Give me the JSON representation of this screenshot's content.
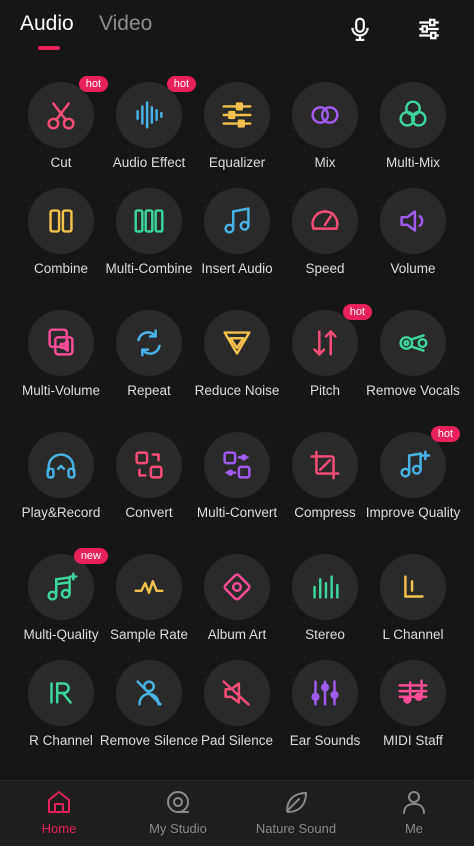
{
  "header": {
    "tabs": [
      {
        "label": "Audio",
        "active": true
      },
      {
        "label": "Video",
        "active": false
      }
    ],
    "icons": [
      "mic-icon",
      "sliders-icon"
    ]
  },
  "grid": [
    {
      "label": "Cut",
      "icon": "scissors-icon",
      "color": "#ff4d7a",
      "badge": "hot"
    },
    {
      "label": "Audio Effect",
      "icon": "waveform-icon",
      "color": "#4ab3e6",
      "badge": "hot"
    },
    {
      "label": "Equalizer",
      "icon": "equalizer-icon",
      "color": "#f2c14e",
      "badge": ""
    },
    {
      "label": "Mix",
      "icon": "mix-circles-icon",
      "color": "#a05cf0",
      "badge": ""
    },
    {
      "label": "Multi-Mix",
      "icon": "multi-mix-icon",
      "color": "#3ed6a0",
      "badge": ""
    },
    {
      "label": "Combine",
      "icon": "combine-icon",
      "color": "#f2c14e",
      "badge": ""
    },
    {
      "label": "Multi-Combine",
      "icon": "multi-combine-icon",
      "color": "#3ed6a0",
      "badge": ""
    },
    {
      "label": "Insert Audio",
      "icon": "music-notes-icon",
      "color": "#4ab3e6",
      "badge": ""
    },
    {
      "label": "Speed",
      "icon": "speedometer-icon",
      "color": "#ff4d7a",
      "badge": ""
    },
    {
      "label": "Volume",
      "icon": "speaker-icon",
      "color": "#a05cf0",
      "badge": ""
    },
    {
      "label": "Multi-Volume",
      "icon": "multi-volume-icon",
      "color": "#ff4d9a",
      "badge": ""
    },
    {
      "label": "Repeat",
      "icon": "repeat-icon",
      "color": "#4ab3e6",
      "badge": ""
    },
    {
      "label": "Reduce Noise",
      "icon": "funnel-icon",
      "color": "#f2c14e",
      "badge": ""
    },
    {
      "label": "Pitch",
      "icon": "pitch-icon",
      "color": "#ff4d7a",
      "badge": "hot"
    },
    {
      "label": "Remove Vocals",
      "icon": "remove-vocals-icon",
      "color": "#3ed6a0",
      "badge": ""
    },
    {
      "label": "Play&Record",
      "icon": "headphones-icon",
      "color": "#4ab3e6",
      "badge": ""
    },
    {
      "label": "Convert",
      "icon": "convert-icon",
      "color": "#ff4d7a",
      "badge": ""
    },
    {
      "label": "Multi-Convert",
      "icon": "multi-convert-icon",
      "color": "#a05cf0",
      "badge": ""
    },
    {
      "label": "Compress",
      "icon": "compress-icon",
      "color": "#ff4d7a",
      "badge": ""
    },
    {
      "label": "Improve Quality",
      "icon": "music-note-plus-icon",
      "color": "#4ab3e6",
      "badge": "hot"
    },
    {
      "label": "Multi-Quality",
      "icon": "multi-quality-icon",
      "color": "#3ed6a0",
      "badge": "new"
    },
    {
      "label": "Sample Rate",
      "icon": "sample-rate-icon",
      "color": "#f2c14e",
      "badge": ""
    },
    {
      "label": "Album Art",
      "icon": "album-art-icon",
      "color": "#ff4d9a",
      "badge": ""
    },
    {
      "label": "Stereo",
      "icon": "stereo-bars-icon",
      "color": "#3ed6a0",
      "badge": ""
    },
    {
      "label": "L Channel",
      "icon": "l-channel-icon",
      "color": "#f2c14e",
      "badge": ""
    },
    {
      "label": "R Channel",
      "icon": "r-channel-icon",
      "color": "#3ed6a0",
      "badge": ""
    },
    {
      "label": "Remove Silence",
      "icon": "remove-silence-icon",
      "color": "#4ab3e6",
      "badge": ""
    },
    {
      "label": "Pad Silence",
      "icon": "mute-speaker-icon",
      "color": "#ff4d7a",
      "badge": ""
    },
    {
      "label": "Ear Sounds",
      "icon": "ear-sounds-icon",
      "color": "#a05cf0",
      "badge": ""
    },
    {
      "label": "MIDI Staff",
      "icon": "midi-staff-icon",
      "color": "#ff4d9a",
      "badge": ""
    }
  ],
  "bottom_nav": [
    {
      "label": "Home",
      "icon": "home-icon",
      "active": true
    },
    {
      "label": "My Studio",
      "icon": "studio-icon",
      "active": false
    },
    {
      "label": "Nature Sound",
      "icon": "leaf-icon",
      "active": false
    },
    {
      "label": "Me",
      "icon": "person-icon",
      "active": false
    }
  ],
  "colors": {
    "accent": "#e8215a",
    "background": "#161616",
    "circle": "#2a2a2a",
    "nav_inactive": "#8a8a8a"
  }
}
